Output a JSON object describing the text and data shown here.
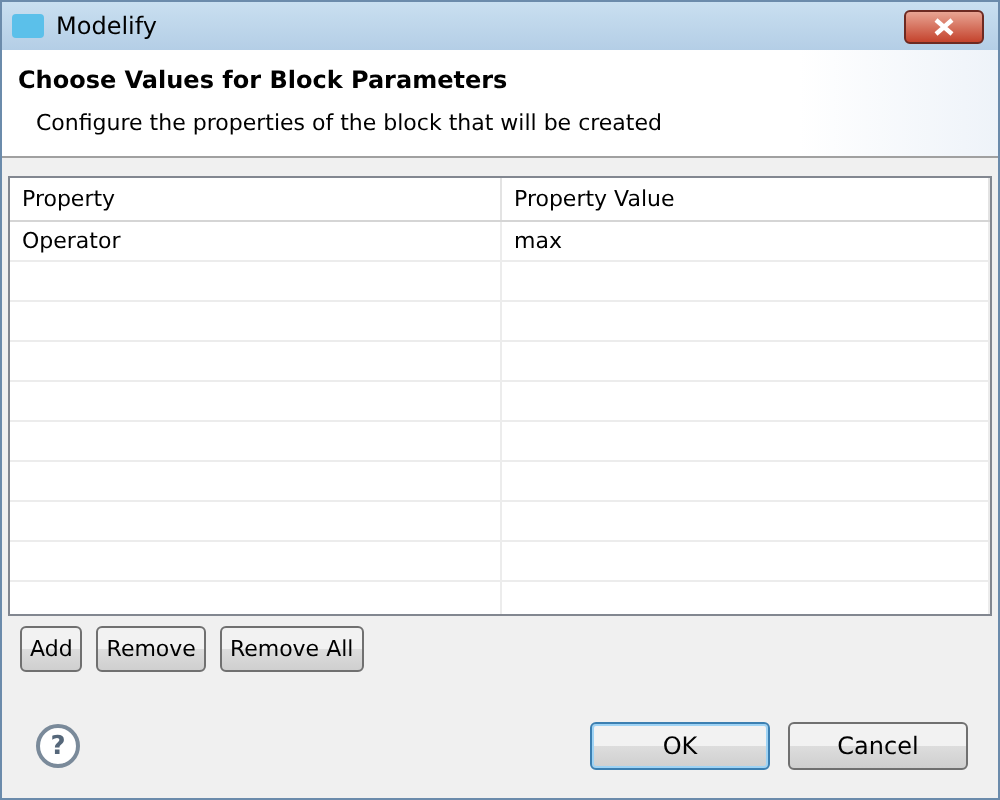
{
  "window": {
    "title": "Modelify"
  },
  "header": {
    "title": "Choose Values for Block Parameters",
    "description": "Configure the properties of the block that will be created"
  },
  "table": {
    "columns": [
      "Property",
      "Property Value"
    ],
    "rows": [
      {
        "cells": [
          "Operator",
          "max"
        ]
      }
    ]
  },
  "table_buttons": [
    "Add",
    "Remove",
    "Remove All"
  ],
  "help": "?",
  "buttons": [
    {
      "label": "OK",
      "default": true
    },
    {
      "label": "Cancel",
      "default": false
    }
  ]
}
